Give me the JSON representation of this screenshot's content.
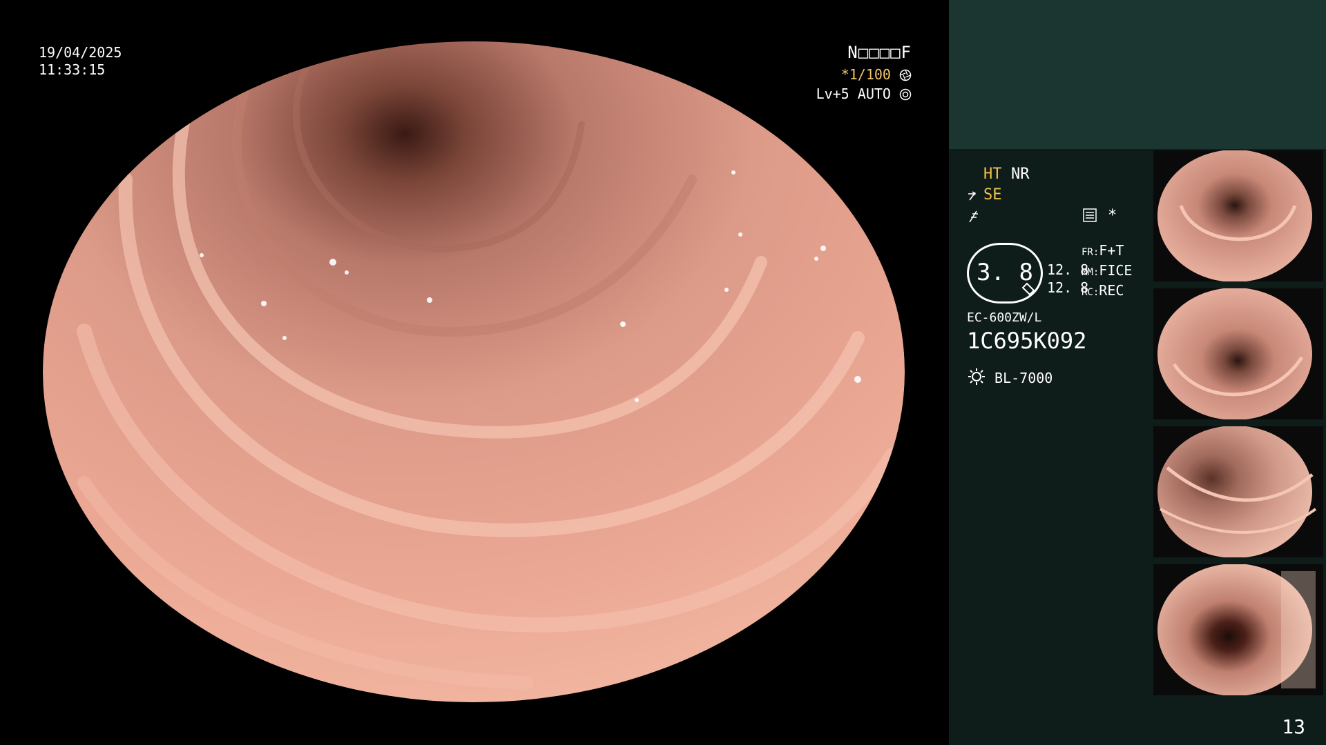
{
  "overlay": {
    "date": "19/04/2025",
    "time": "11:33:15",
    "patient_code": "N□□□□F",
    "shutter": "*1/100",
    "shutter_icon": "aperture-icon",
    "level": "Lv+5",
    "iris_mode": "AUTO",
    "iris_icon": "iris-icon"
  },
  "panel": {
    "ht": "HT",
    "nr": "NR",
    "se": "SE",
    "big_value": "3. 8",
    "value_a": "12. 8",
    "value_b": "12. 8",
    "fr_label": "FR:",
    "fr_value": "F+T",
    "mm_label": "MM:",
    "mm_value": "FICE",
    "rc_label": "RC:",
    "rc_value": "REC",
    "asterisk": "*",
    "scope_model": "EC-600ZW/L",
    "scope_serial": "1C695K092",
    "light_source": "BL-7000",
    "page_number": "13"
  },
  "colors": {
    "mucosa": "#e6a08e",
    "panel_bg": "#0f1d1a",
    "panel_top": "#1b3631",
    "accent_yellow": "#f2c14d"
  }
}
